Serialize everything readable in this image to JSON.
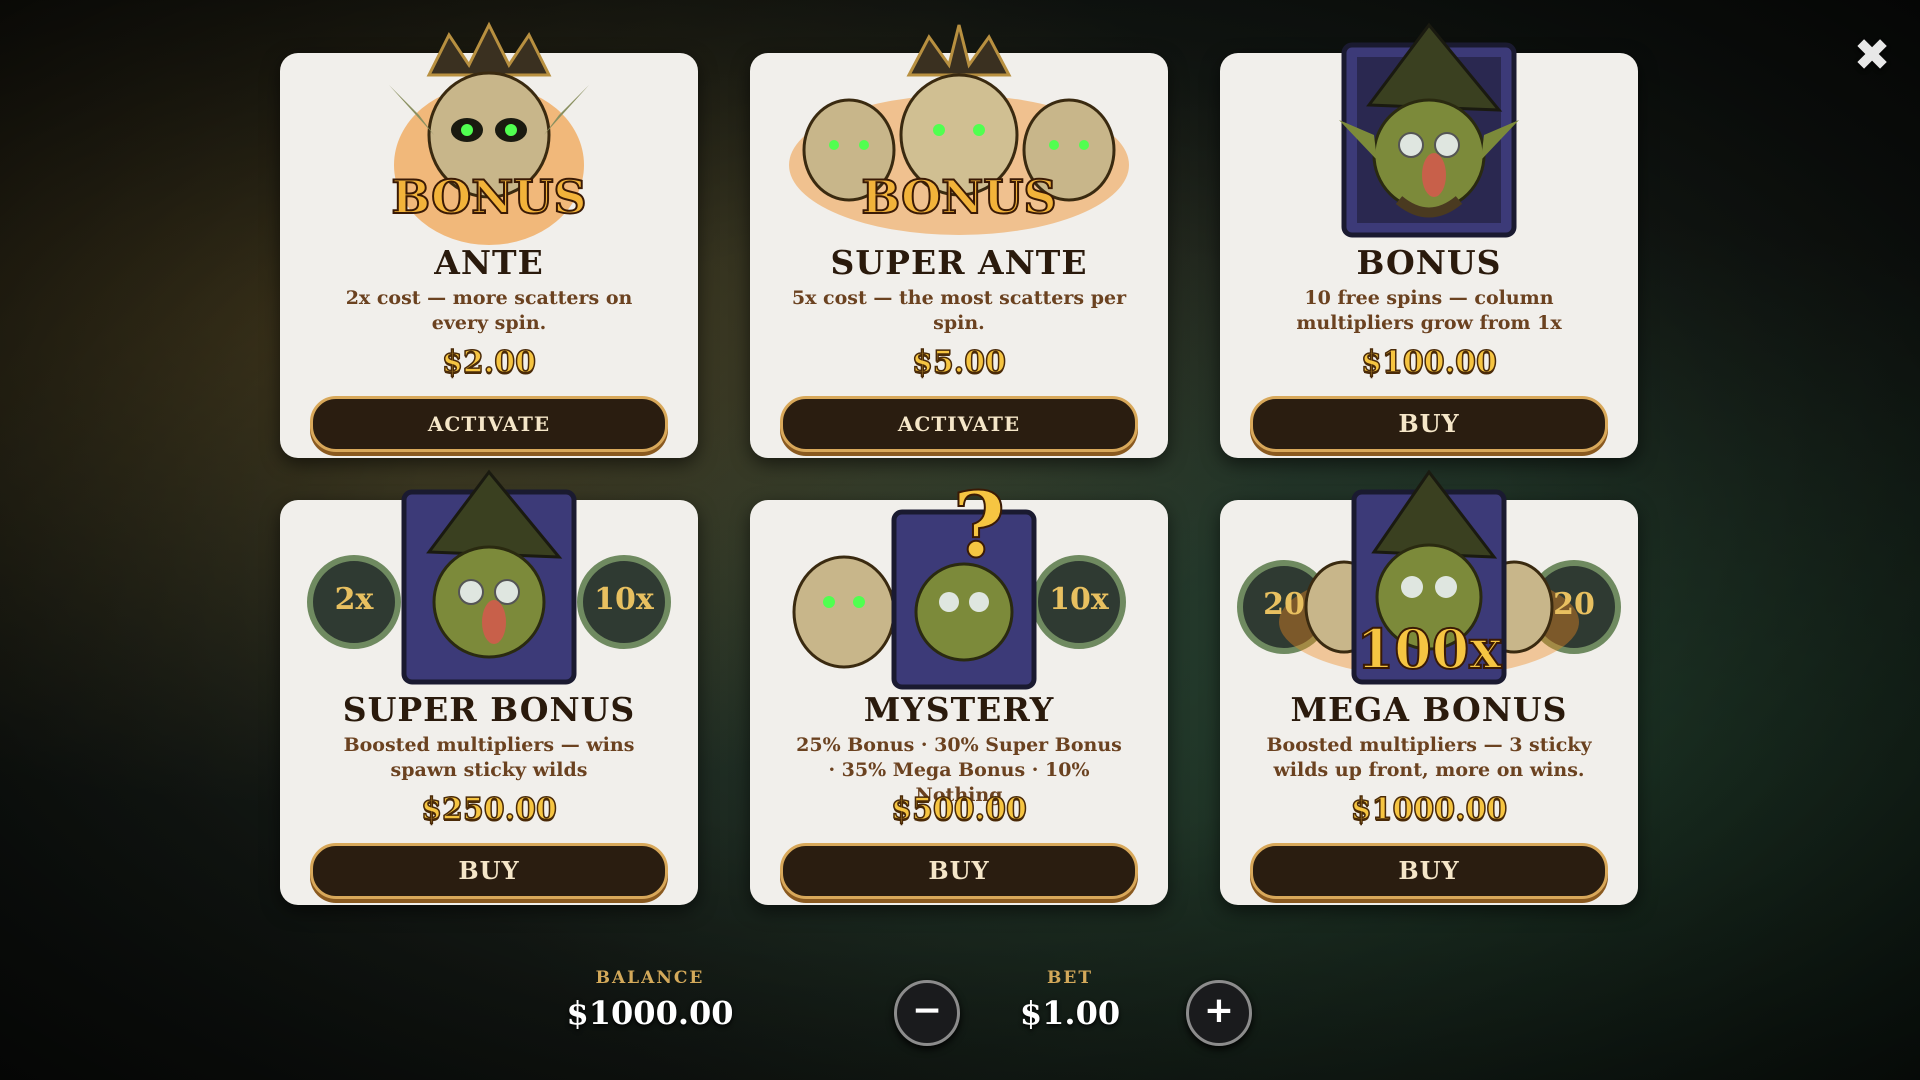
{
  "overlay": {
    "close_icon": "close-icon",
    "colors": {
      "card_bg": "#f1efeb",
      "price_gold": "#f6c542",
      "button_bg": "#2a1d10",
      "button_border": "#d8a85a",
      "label_gold": "#d3a95a"
    }
  },
  "cards": [
    {
      "title": "ANTE",
      "desc": "2x cost — more scatters on every spin.",
      "price": "$2.00",
      "button": "ACTIVATE",
      "art": "bonus-skull-icon"
    },
    {
      "title": "SUPER ANTE",
      "desc": "5x cost — the most scatters per spin.",
      "price": "$5.00",
      "button": "ACTIVATE",
      "art": "triple-bonus-skull-icon"
    },
    {
      "title": "BONUS",
      "desc": "10 free spins — column multipliers grow from 1x",
      "price": "$100.00",
      "button": "BUY",
      "art": "goblin-wizard-icon"
    },
    {
      "title": "SUPER BONUS",
      "desc": "Boosted multipliers — wins spawn sticky wilds",
      "price": "$250.00",
      "button": "BUY",
      "art": "goblin-with-coins-icon",
      "coin_left": "2x",
      "coin_right": "10x"
    },
    {
      "title": "MYSTERY",
      "desc": "25% Bonus · 30% Super Bonus · 35% Mega Bonus · 10% Nothing",
      "price": "$500.00",
      "button": "BUY",
      "art": "mystery-goblin-icon",
      "coin_right": "10x",
      "mark": "?"
    },
    {
      "title": "MEGA BONUS",
      "desc": "Boosted multipliers — 3 sticky wilds up front, more on wins.",
      "price": "$1000.00",
      "button": "BUY",
      "art": "mega-goblin-icon",
      "coin_left": "20",
      "coin_right": "20",
      "multiplier": "100x"
    }
  ],
  "bottom": {
    "balance_label": "BALANCE",
    "balance_value": "$1000.00",
    "bet_label": "BET",
    "bet_value": "$1.00",
    "minus_label": "−",
    "plus_label": "+"
  }
}
